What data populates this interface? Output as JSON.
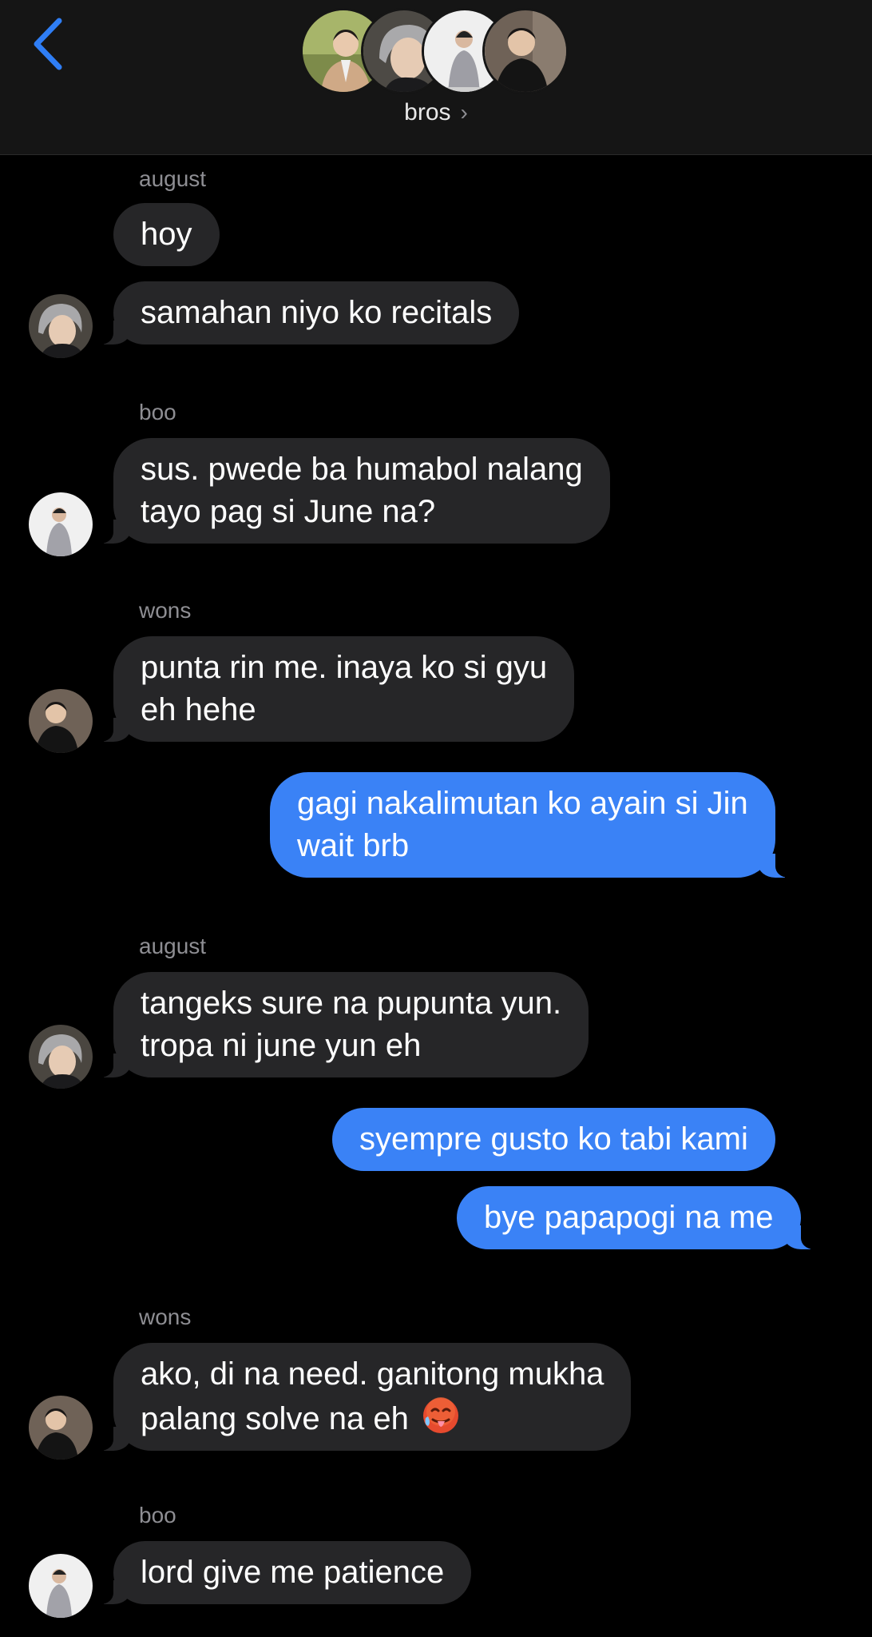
{
  "header": {
    "title": "bros",
    "chevron": "›"
  },
  "messages": {
    "s1": "august",
    "m1": "hoy",
    "m2": "samahan niyo ko recitals",
    "s2": "boo",
    "m3": "sus. pwede ba humabol nalang\ntayo pag si June na?",
    "s3": "wons",
    "m4": "punta rin me. inaya ko si gyu\neh hehe",
    "m5": "gagi nakalimutan ko ayain si Jin\nwait brb",
    "s4": "august",
    "m6": "tangeks sure na pupunta yun.\ntropa ni june yun eh",
    "m7": "syempre gusto ko tabi kami",
    "m8": "bye papapogi na me",
    "s5": "wons",
    "m9": "ako, di na need. ganitong mukha\npalang solve na eh ",
    "s6": "boo",
    "m10": "lord give me patience"
  },
  "icons": {
    "back": "chevron-left-icon",
    "emoji": "hot-face-emoji-icon"
  },
  "colors": {
    "accent": "#3a82f6",
    "incoming_bubble": "#262628",
    "header_bg": "#151515",
    "back_icon": "#2f7ef5"
  }
}
